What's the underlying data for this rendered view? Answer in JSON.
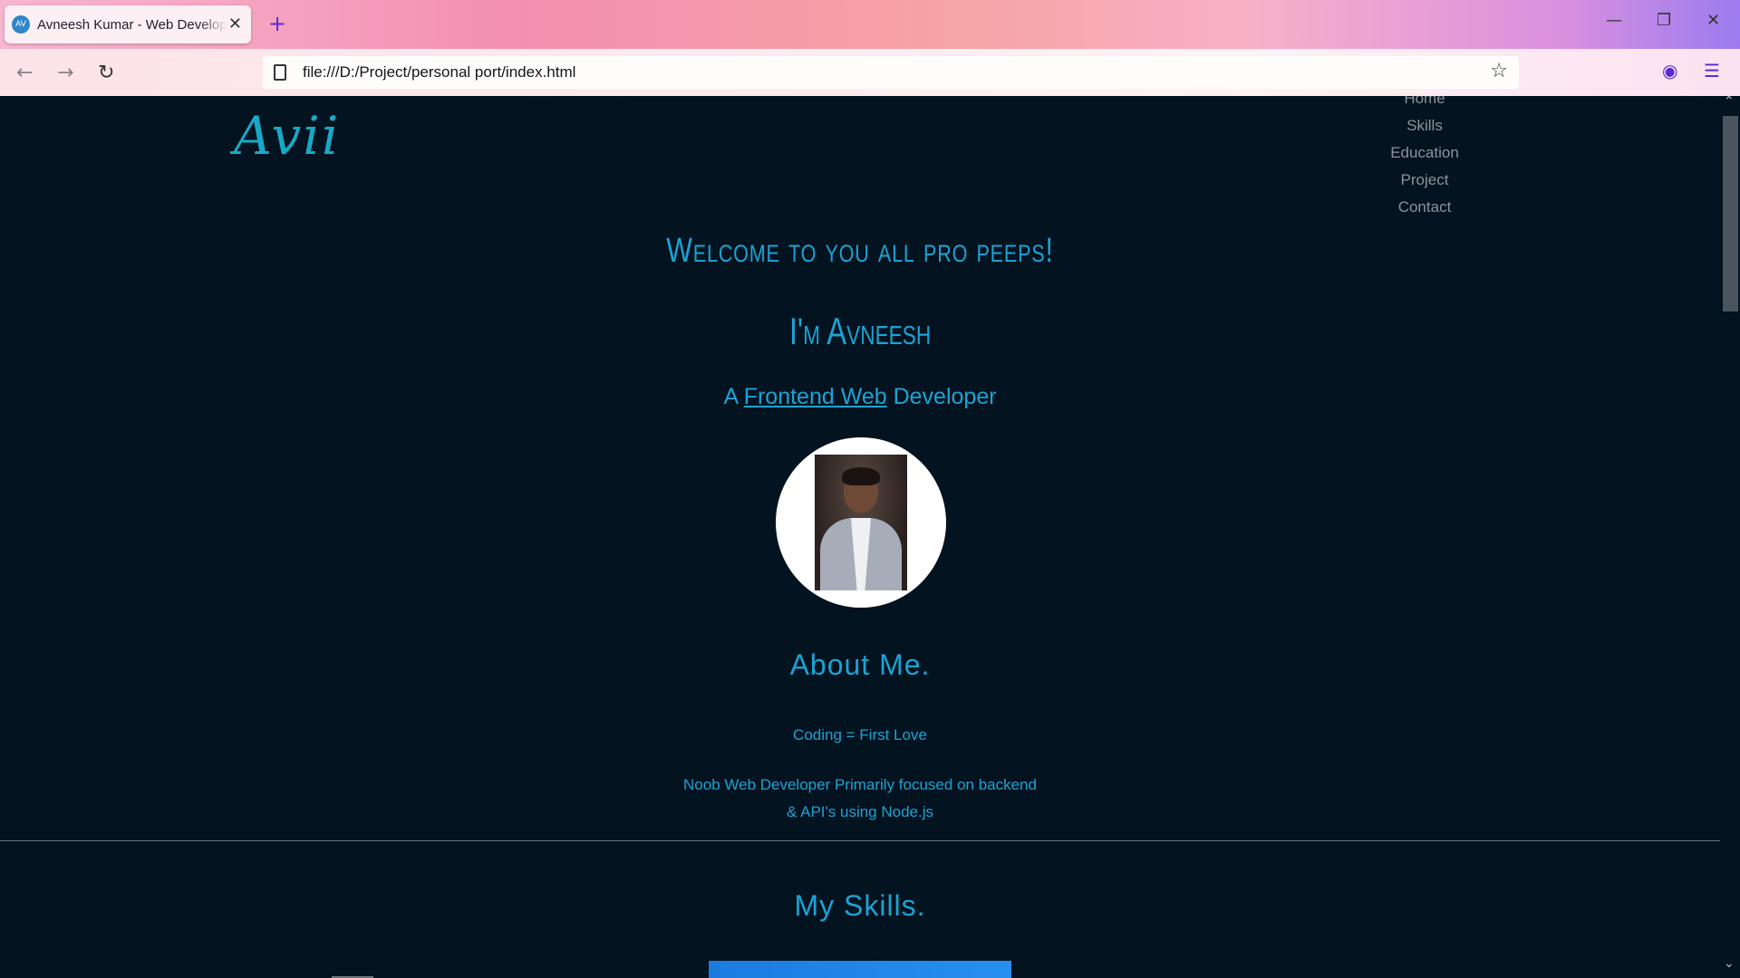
{
  "browser": {
    "tab_title": "Avneesh Kumar - Web Developer",
    "tab_favicon_text": "AV",
    "new_tab_glyph": "+",
    "close_tab_glyph": "✕",
    "url": "file:///D:/Project/personal port/index.html"
  },
  "icons": {
    "back": "back-arrow-icon",
    "forward": "forward-arrow-icon",
    "reload": "reload-icon",
    "bookmark": "star-icon",
    "pocket": "pocket-icon",
    "menu": "hamburger-menu-icon",
    "minimize": "minimize-icon",
    "restore": "restore-icon",
    "close": "close-window-icon"
  },
  "site": {
    "logo": "Avii",
    "nav": [
      "Home",
      "Skills",
      "Education",
      "Project",
      "Contact"
    ],
    "welcome": "Welcome to you all pro peeps!",
    "intro": "I'm Avneesh",
    "tagline_prefix": "A ",
    "tagline_highlight": "Frontend Web",
    "tagline_suffix": " Developer",
    "about_title": "About Me.",
    "about_line1": "Coding = First Love",
    "about_line2a": "Noob Web Developer Primarily focused on backend",
    "about_line2b": "& API's using Node.js",
    "skills_title": "My Skills."
  },
  "colors": {
    "page_bg": "#03131f",
    "accent": "#1ba3d4",
    "nav_text": "#8c939b",
    "logo": "#18a9c7"
  }
}
